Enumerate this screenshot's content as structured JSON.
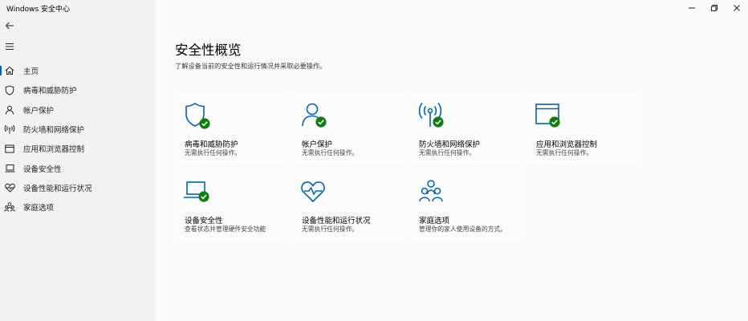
{
  "window": {
    "title": "Windows 安全中心"
  },
  "colors": {
    "accent": "#0063b1",
    "ok": "#107c10",
    "sidebar_bg": "#f2f2f2",
    "content_bg": "#fafafa"
  },
  "sidebar": {
    "items": [
      {
        "label": "主页",
        "icon": "home-icon",
        "active": true
      },
      {
        "label": "病毒和威胁防护",
        "icon": "shield-icon",
        "active": false
      },
      {
        "label": "帐户保护",
        "icon": "person-icon",
        "active": false
      },
      {
        "label": "防火墙和网络保护",
        "icon": "antenna-icon",
        "active": false
      },
      {
        "label": "应用和浏览器控制",
        "icon": "browser-window-icon",
        "active": false
      },
      {
        "label": "设备安全性",
        "icon": "laptop-icon",
        "active": false
      },
      {
        "label": "设备性能和运行状况",
        "icon": "heart-icon",
        "active": false
      },
      {
        "label": "家庭选项",
        "icon": "family-icon",
        "active": false
      }
    ]
  },
  "main": {
    "title": "安全性概览",
    "subtitle": "了解设备当前的安全性和运行情况并采取必要操作。",
    "tiles": [
      {
        "title": "病毒和威胁防护",
        "status": "无需执行任何操作。",
        "icon": "shield-icon",
        "badge": "check-badge-icon"
      },
      {
        "title": "帐户保护",
        "status": "无需执行任何操作。",
        "icon": "person-icon",
        "badge": "check-badge-icon"
      },
      {
        "title": "防火墙和网络保护",
        "status": "无需执行任何操作。",
        "icon": "antenna-icon",
        "badge": "check-badge-icon"
      },
      {
        "title": "应用和浏览器控制",
        "status": "无需执行任何操作。",
        "icon": "browser-window-icon",
        "badge": "check-badge-icon"
      },
      {
        "title": "设备安全性",
        "status": "查看状态并管理硬件安全功能",
        "icon": "laptop-icon",
        "badge": "check-badge-icon"
      },
      {
        "title": "设备性能和运行状况",
        "status": "无需执行任何操作。",
        "icon": "heart-icon",
        "badge": null
      },
      {
        "title": "家庭选项",
        "status": "管理你的家人使用设备的方式。",
        "icon": "family-icon",
        "badge": null
      }
    ]
  }
}
